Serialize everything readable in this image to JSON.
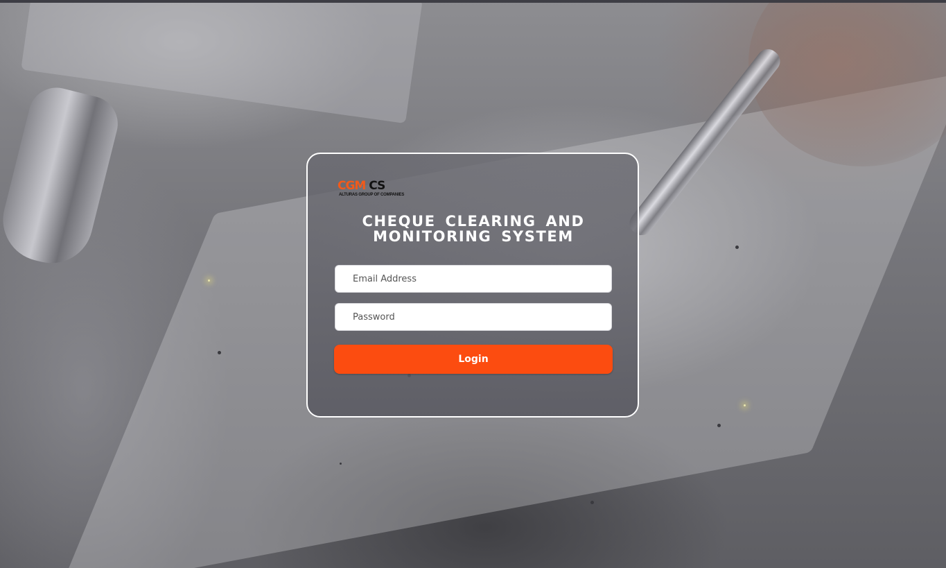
{
  "logo": {
    "mark_part1": "CGM",
    "mark_part2": "CS",
    "tagline": "ALTURAS GROUP OF COMPANIES"
  },
  "title": {
    "line1": "CHEQUE CLEARING AND",
    "line2": "MONITORING SYSTEM"
  },
  "form": {
    "email_placeholder": "Email Address",
    "email_value": "",
    "password_placeholder": "Password",
    "password_value": "",
    "login_label": "Login"
  },
  "colors": {
    "accent": "#fc4c10",
    "logo_orange": "#f25a1a",
    "card_border": "#ffffff"
  }
}
